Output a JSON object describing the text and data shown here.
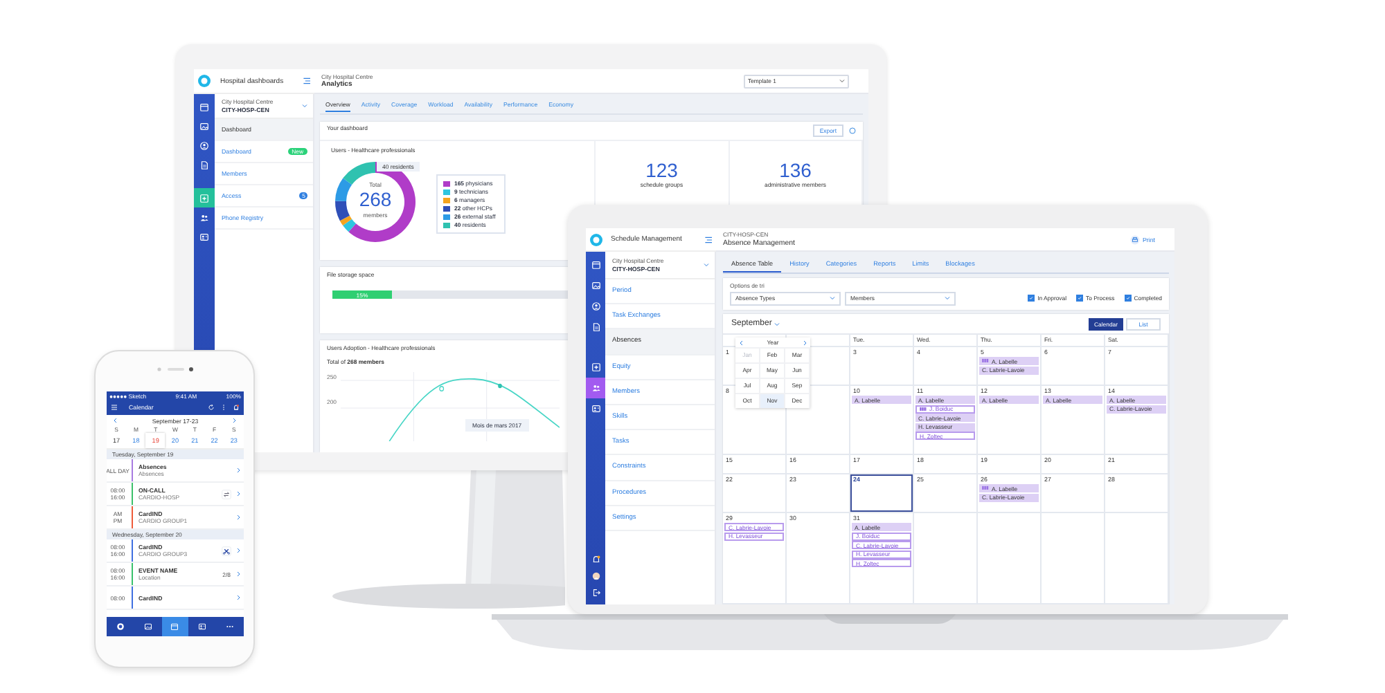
{
  "monitor": {
    "app_title": "Hospital dashboards",
    "org_small": "City Hospital Centre",
    "page_title": "Analytics",
    "template_select": "Template 1",
    "rail": {
      "top": [
        {
          "selected": false
        },
        {
          "selected": false
        },
        {
          "selected": false
        },
        {
          "selected": false
        }
      ],
      "bottom": [
        {
          "selected": true
        },
        {
          "selected": false
        },
        {
          "selected": false
        }
      ]
    },
    "sidebar": {
      "org_label": "City Hospital Centre",
      "org_code": "CITY-HOSP-CEN",
      "items": [
        {
          "label": "Dashboard",
          "selected": true
        },
        {
          "label": "Dashboard",
          "selected": false,
          "badge": "New",
          "kind": "new"
        },
        {
          "label": "Members",
          "selected": false
        },
        {
          "label": "Access",
          "selected": false,
          "badge": "5",
          "kind": "count"
        },
        {
          "label": "Phone Registry",
          "selected": false
        }
      ]
    },
    "tabs": [
      {
        "label": "Overview",
        "selected": true
      },
      {
        "label": "Activity",
        "selected": false
      },
      {
        "label": "Coverage",
        "selected": false
      },
      {
        "label": "Workload",
        "selected": false
      },
      {
        "label": "Availability",
        "selected": false
      },
      {
        "label": "Performance",
        "selected": false
      },
      {
        "label": "Economy",
        "selected": false
      }
    ],
    "dashboard_title": "Your dashboard",
    "export_button": "Export",
    "donut": {
      "title": "Users - Healthcare professionals",
      "total_label": "Total",
      "total": "268",
      "unit": "members",
      "tooltip": "40 residents",
      "legend": [
        {
          "count": "165",
          "color": "#b03cc8"
        },
        {
          "count": "9",
          "color": "#2ec5e0"
        },
        {
          "count": "6",
          "color": "#f5a41f"
        },
        {
          "count": "22",
          "color": "#2f4fb8"
        },
        {
          "count": "26",
          "color": "#2d9be6"
        },
        {
          "count": "40",
          "color": "#2fc2b0"
        }
      ],
      "chart_data": {
        "type": "donut",
        "categories": [
          "physicians",
          "technicians",
          "managers",
          "other HCPs",
          "external staff",
          "residents"
        ],
        "values": [
          61.6,
          3.4,
          2.2,
          8.2,
          9.7,
          14.9
        ]
      }
    },
    "stats": [
      {
        "value": "123",
        "label": "schedule groups"
      },
      {
        "value": "136",
        "label": "administrative members"
      }
    ],
    "storage": {
      "title": "File storage space",
      "level": 0.15,
      "reading": "15%"
    },
    "adoption": {
      "title": "Users Adoption - Healthcare professionals",
      "total": "Total of **268 members**",
      "axis_labels": [
        "250",
        "200"
      ],
      "tooltip": "Mois de mars 2017"
    }
  },
  "laptop": {
    "app_title": "Schedule Management",
    "org_small": "CITY-HOSP-CEN",
    "page_title": "Absence Management",
    "print_button": "Print",
    "rail": {
      "top": [
        {
          "selected": false
        },
        {
          "selected": false
        },
        {
          "selected": false
        },
        {
          "selected": false
        }
      ],
      "bottom": [
        {
          "selected": false
        },
        {
          "selected": true
        },
        {
          "selected": false
        }
      ]
    },
    "sidebar": {
      "org_label": "City Hospital Centre",
      "org_code": "CITY-HOSP-CEN",
      "items": [
        {
          "label": "Period",
          "selected": false
        },
        {
          "label": "Task Exchanges",
          "selected": false
        },
        {
          "label": "Absences",
          "selected": true
        },
        {
          "label": "Equity",
          "selected": false
        },
        {
          "label": "Members",
          "selected": false
        },
        {
          "label": "Skills",
          "selected": false
        },
        {
          "label": "Tasks",
          "selected": false
        },
        {
          "label": "Constraints",
          "selected": false
        },
        {
          "label": "Procedures",
          "selected": false
        },
        {
          "label": "Settings",
          "selected": false
        }
      ]
    },
    "tabs": [
      {
        "label": "Absence Table",
        "selected": true
      },
      {
        "label": "History",
        "selected": false
      },
      {
        "label": "Categories",
        "selected": false
      },
      {
        "label": "Reports",
        "selected": false
      },
      {
        "label": "Limits",
        "selected": false
      },
      {
        "label": "Blockages",
        "selected": false
      }
    ],
    "options_label": "Options de tri",
    "selects": [
      {
        "value": "Absence Types"
      },
      {
        "value": "Members"
      }
    ],
    "filters": [
      {
        "label": "In Approval",
        "checked": true
      },
      {
        "label": "To Process",
        "checked": true
      },
      {
        "label": "Completed",
        "checked": true
      }
    ],
    "month": "September",
    "views": [
      {
        "label": "Calendar",
        "selected": true
      },
      {
        "label": "List",
        "selected": false
      }
    ],
    "month_picker": {
      "year_label": "Year",
      "months": [
        {
          "label": "Jan",
          "disabled": true,
          "hovered": false
        },
        {
          "label": "Feb",
          "disabled": false,
          "hovered": false
        },
        {
          "label": "Mar",
          "disabled": false,
          "hovered": false
        },
        {
          "label": "Apr",
          "disabled": false,
          "hovered": false
        },
        {
          "label": "May",
          "disabled": false,
          "hovered": false
        },
        {
          "label": "Jun",
          "disabled": false,
          "hovered": false
        },
        {
          "label": "Jul",
          "disabled": false,
          "hovered": false
        },
        {
          "label": "Aug",
          "disabled": false,
          "hovered": false
        },
        {
          "label": "Sep",
          "disabled": false,
          "hovered": false
        },
        {
          "label": "Oct",
          "disabled": false,
          "hovered": false
        },
        {
          "label": "Nov",
          "disabled": false,
          "hovered": true
        },
        {
          "label": "Dec",
          "disabled": false,
          "hovered": false
        }
      ]
    },
    "day_headers": [
      "Tue.",
      "Wed.",
      "Thu.",
      "Fri.",
      "Sat."
    ],
    "weeks": [
      [
        {
          "day": "1",
          "today": false
        },
        {
          "day": "3",
          "today": false
        },
        {
          "day": "4",
          "today": false
        },
        {
          "day": "5",
          "today": false,
          "events": [
            {
              "label": "A. Labelle",
              "kind": "filled",
              "striped": true
            },
            {
              "label": "C. Labrie-Lavoie",
              "kind": "filled",
              "striped": false
            }
          ]
        },
        {
          "day": "6",
          "today": false
        },
        {
          "day": "7",
          "today": false
        }
      ],
      [
        {
          "day": "8",
          "today": false
        },
        {
          "day": "10",
          "today": false,
          "events": [
            {
              "label": "A. Labelle",
              "kind": "filled",
              "striped": false
            }
          ]
        },
        {
          "day": "11",
          "today": false,
          "events": [
            {
              "label": "A. Labelle",
              "kind": "filled",
              "striped": false
            },
            {
              "label": "J. Boiduc",
              "kind": "outline",
              "striped": true
            },
            {
              "label": "C. Labrie-Lavoie",
              "kind": "filled",
              "striped": false
            },
            {
              "label": "H. Levasseur",
              "kind": "filled",
              "striped": false
            },
            {
              "label": "H. Zoltec",
              "kind": "outline",
              "striped": false
            }
          ]
        },
        {
          "day": "12",
          "today": false,
          "events": [
            {
              "label": "A. Labelle",
              "kind": "filled",
              "striped": false
            }
          ]
        },
        {
          "day": "13",
          "today": false,
          "events": [
            {
              "label": "A. Labelle",
              "kind": "filled",
              "striped": false
            }
          ]
        },
        {
          "day": "14",
          "today": false,
          "events": [
            {
              "label": "A. Labelle",
              "kind": "filled",
              "striped": false
            },
            {
              "label": "C. Labrie-Lavoie",
              "kind": "filled",
              "striped": false
            }
          ]
        }
      ],
      [
        {
          "day": "15",
          "today": false
        },
        {
          "day": "16",
          "today": false
        },
        {
          "day": "17",
          "today": false
        },
        {
          "day": "18",
          "today": false
        },
        {
          "day": "19",
          "today": false
        },
        {
          "day": "20",
          "today": false
        },
        {
          "day": "21",
          "today": false
        }
      ],
      [
        {
          "day": "22",
          "today": false
        },
        {
          "day": "23",
          "today": false
        },
        {
          "day": "24",
          "today": true
        },
        {
          "day": "25",
          "today": false
        },
        {
          "day": "26",
          "today": false,
          "events": [
            {
              "label": "A. Labelle",
              "kind": "filled",
              "striped": true
            },
            {
              "label": "C. Labrie-Lavoie",
              "kind": "filled",
              "striped": false
            }
          ]
        },
        {
          "day": "27",
          "today": false
        },
        {
          "day": "28",
          "today": false
        }
      ],
      [
        {
          "day": "29",
          "today": false,
          "events": [
            {
              "label": "C. Labrie-Lavoie",
              "kind": "outline",
              "striped": false
            },
            {
              "label": "H. Levasseur",
              "kind": "outline",
              "striped": false
            }
          ]
        },
        {
          "day": "30",
          "today": false
        },
        {
          "day": "31",
          "today": false,
          "events": [
            {
              "label": "A. Labelle",
              "kind": "filled",
              "striped": false
            },
            {
              "label": "J. Boiduc",
              "kind": "outline",
              "striped": false
            },
            {
              "label": "C. Labrie-Lavoie",
              "kind": "outline",
              "striped": false
            },
            {
              "label": "H. Levasseur",
              "kind": "outline",
              "striped": false
            },
            {
              "label": "H. Zoltec",
              "kind": "outline",
              "striped": false
            }
          ]
        }
      ]
    ]
  },
  "phone": {
    "carrier": "●●●●● Sketch",
    "time": "9:41 AM",
    "battery": "100%",
    "title": "Calendar",
    "week_label": "September 17-23",
    "weekdays": [
      "S",
      "M",
      "T",
      "W",
      "T",
      "F",
      "S"
    ],
    "dates": [
      {
        "label": "17",
        "selected": false,
        "has_events": false
      },
      {
        "label": "18",
        "selected": false,
        "has_events": true
      },
      {
        "label": "19",
        "selected": true,
        "has_events": true
      },
      {
        "label": "20",
        "selected": false,
        "has_events": true
      },
      {
        "label": "21",
        "selected": false,
        "has_events": true
      },
      {
        "label": "22",
        "selected": false,
        "has_events": true
      },
      {
        "label": "23",
        "selected": false,
        "has_events": true
      }
    ],
    "sections": [
      {
        "heading": "Tuesday, September 19",
        "events": [
          {
            "start": "ALL DAY",
            "title": "Absences",
            "subtitle": "Absences",
            "color": "#a77be0",
            "kind": "plain"
          },
          {
            "start": "08:00",
            "end": "16:00",
            "title": "ON-CALL",
            "subtitle": "CARDIO-HOSP",
            "color": "#3cc06a",
            "kind": "swap"
          },
          {
            "start": "AM",
            "end": "PM",
            "title": "CardIND",
            "subtitle": "CARDIO GROUP1",
            "color": "#ee5b3a",
            "kind": "plain"
          }
        ]
      },
      {
        "heading": "Wednesday, September 20",
        "events": [
          {
            "start": "08:00",
            "end": "16:00",
            "title": "CardIND",
            "subtitle": "CARDIO GROUP3",
            "color": "#3f6fe0",
            "kind": "cut"
          },
          {
            "start": "08:00",
            "end": "16:00",
            "title": "EVENT NAME",
            "subtitle": "Location",
            "color": "#39c16b",
            "kind": "count",
            "count": "2/8"
          },
          {
            "start": "08:00",
            "title": "CardIND",
            "color": "#3f6fe0",
            "kind": "plain"
          }
        ]
      }
    ],
    "nav": [
      {
        "selected": false
      },
      {
        "selected": false
      },
      {
        "selected": true
      },
      {
        "selected": false
      },
      {
        "selected": false
      }
    ]
  }
}
